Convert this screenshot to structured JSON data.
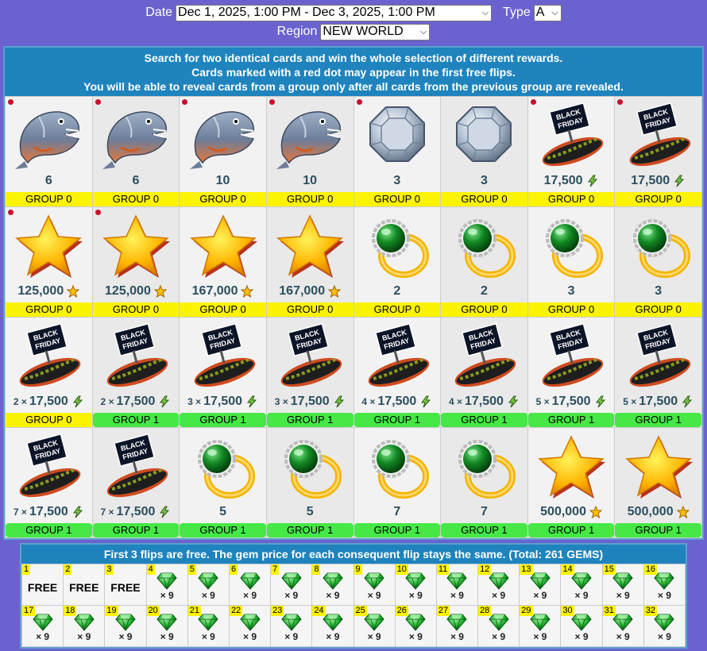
{
  "filters": {
    "date_label": "Date",
    "date_value": "Dec 1, 2025, 1:00 PM - Dec 3, 2025, 1:00 PM",
    "type_label": "Type",
    "type_value": "A",
    "region_label": "Region",
    "region_value": "NEW WORLD"
  },
  "info": {
    "line1": "Search for two identical cards and win the whole selection of different rewards.",
    "line2": "Cards marked with a red dot may appear in the first free flips.",
    "line3": "You will be able to reveal cards from a group only after all cards from the previous group are revealed."
  },
  "cards": [
    {
      "icon": "piranha-icon",
      "mult": "",
      "value": "6",
      "value_icon": "",
      "group": "GROUP 0",
      "red_dot": true
    },
    {
      "icon": "piranha-icon",
      "mult": "",
      "value": "6",
      "value_icon": "",
      "group": "GROUP 0",
      "red_dot": true
    },
    {
      "icon": "piranha-icon",
      "mult": "",
      "value": "10",
      "value_icon": "",
      "group": "GROUP 0",
      "red_dot": true
    },
    {
      "icon": "piranha-icon",
      "mult": "",
      "value": "10",
      "value_icon": "",
      "group": "GROUP 0",
      "red_dot": true
    },
    {
      "icon": "diamond-icon",
      "mult": "",
      "value": "3",
      "value_icon": "",
      "group": "GROUP 0",
      "red_dot": true
    },
    {
      "icon": "diamond-icon",
      "mult": "",
      "value": "3",
      "value_icon": "",
      "group": "GROUP 0",
      "red_dot": false
    },
    {
      "icon": "hotdog-black-friday-icon",
      "mult": "",
      "value": "17,500",
      "value_icon": "bolt",
      "group": "GROUP 0",
      "red_dot": true
    },
    {
      "icon": "hotdog-black-friday-icon",
      "mult": "",
      "value": "17,500",
      "value_icon": "bolt",
      "group": "GROUP 0",
      "red_dot": true
    },
    {
      "icon": "star-icon",
      "mult": "",
      "value": "125,000",
      "value_icon": "star",
      "group": "GROUP 0",
      "red_dot": true
    },
    {
      "icon": "star-icon",
      "mult": "",
      "value": "125,000",
      "value_icon": "star",
      "group": "GROUP 0",
      "red_dot": true
    },
    {
      "icon": "star-icon",
      "mult": "",
      "value": "167,000",
      "value_icon": "star",
      "group": "GROUP 0",
      "red_dot": false
    },
    {
      "icon": "star-icon",
      "mult": "",
      "value": "167,000",
      "value_icon": "star",
      "group": "GROUP 0",
      "red_dot": false
    },
    {
      "icon": "emerald-ring-icon",
      "mult": "",
      "value": "2",
      "value_icon": "",
      "group": "GROUP 0",
      "red_dot": false
    },
    {
      "icon": "emerald-ring-icon",
      "mult": "",
      "value": "2",
      "value_icon": "",
      "group": "GROUP 0",
      "red_dot": false
    },
    {
      "icon": "emerald-ring-icon",
      "mult": "",
      "value": "3",
      "value_icon": "",
      "group": "GROUP 0",
      "red_dot": false
    },
    {
      "icon": "emerald-ring-icon",
      "mult": "",
      "value": "3",
      "value_icon": "",
      "group": "GROUP 0",
      "red_dot": false
    },
    {
      "icon": "hotdog-black-friday-icon",
      "mult": "2 ×",
      "value": "17,500",
      "value_icon": "bolt",
      "group": "GROUP 0",
      "red_dot": false
    },
    {
      "icon": "hotdog-black-friday-icon",
      "mult": "2 ×",
      "value": "17,500",
      "value_icon": "bolt",
      "group": "GROUP 1",
      "red_dot": false
    },
    {
      "icon": "hotdog-black-friday-icon",
      "mult": "3 ×",
      "value": "17,500",
      "value_icon": "bolt",
      "group": "GROUP 1",
      "red_dot": false
    },
    {
      "icon": "hotdog-black-friday-icon",
      "mult": "3 ×",
      "value": "17,500",
      "value_icon": "bolt",
      "group": "GROUP 1",
      "red_dot": false
    },
    {
      "icon": "hotdog-black-friday-icon",
      "mult": "4 ×",
      "value": "17,500",
      "value_icon": "bolt",
      "group": "GROUP 1",
      "red_dot": false
    },
    {
      "icon": "hotdog-black-friday-icon",
      "mult": "4 ×",
      "value": "17,500",
      "value_icon": "bolt",
      "group": "GROUP 1",
      "red_dot": false
    },
    {
      "icon": "hotdog-black-friday-icon",
      "mult": "5 ×",
      "value": "17,500",
      "value_icon": "bolt",
      "group": "GROUP 1",
      "red_dot": false
    },
    {
      "icon": "hotdog-black-friday-icon",
      "mult": "5 ×",
      "value": "17,500",
      "value_icon": "bolt",
      "group": "GROUP 1",
      "red_dot": false
    },
    {
      "icon": "hotdog-black-friday-icon",
      "mult": "7 ×",
      "value": "17,500",
      "value_icon": "bolt",
      "group": "GROUP 1",
      "red_dot": false
    },
    {
      "icon": "hotdog-black-friday-icon",
      "mult": "7 ×",
      "value": "17,500",
      "value_icon": "bolt",
      "group": "GROUP 1",
      "red_dot": false
    },
    {
      "icon": "emerald-ring-icon",
      "mult": "",
      "value": "5",
      "value_icon": "",
      "group": "GROUP 1",
      "red_dot": false
    },
    {
      "icon": "emerald-ring-icon",
      "mult": "",
      "value": "5",
      "value_icon": "",
      "group": "GROUP 1",
      "red_dot": false
    },
    {
      "icon": "emerald-ring-icon",
      "mult": "",
      "value": "7",
      "value_icon": "",
      "group": "GROUP 1",
      "red_dot": false
    },
    {
      "icon": "emerald-ring-icon",
      "mult": "",
      "value": "7",
      "value_icon": "",
      "group": "GROUP 1",
      "red_dot": false
    },
    {
      "icon": "star-icon",
      "mult": "",
      "value": "500,000",
      "value_icon": "star",
      "group": "GROUP 1",
      "red_dot": false
    },
    {
      "icon": "star-icon",
      "mult": "",
      "value": "500,000",
      "value_icon": "star",
      "group": "GROUP 1",
      "red_dot": false
    }
  ],
  "flips_info": "First 3 flips are free. The gem price for each consequent flip stays the same. (Total: 261 GEMS)",
  "flips": [
    {
      "n": "1",
      "free": "FREE"
    },
    {
      "n": "2",
      "free": "FREE"
    },
    {
      "n": "3",
      "free": "FREE"
    },
    {
      "n": "4",
      "cost": "× 9"
    },
    {
      "n": "5",
      "cost": "× 9"
    },
    {
      "n": "6",
      "cost": "× 9"
    },
    {
      "n": "7",
      "cost": "× 9"
    },
    {
      "n": "8",
      "cost": "× 9"
    },
    {
      "n": "9",
      "cost": "× 9"
    },
    {
      "n": "10",
      "cost": "× 9"
    },
    {
      "n": "11",
      "cost": "× 9"
    },
    {
      "n": "12",
      "cost": "× 9"
    },
    {
      "n": "13",
      "cost": "× 9"
    },
    {
      "n": "14",
      "cost": "× 9"
    },
    {
      "n": "15",
      "cost": "× 9"
    },
    {
      "n": "16",
      "cost": "× 9"
    },
    {
      "n": "17",
      "cost": "× 9"
    },
    {
      "n": "18",
      "cost": "× 9"
    },
    {
      "n": "19",
      "cost": "× 9"
    },
    {
      "n": "20",
      "cost": "× 9"
    },
    {
      "n": "21",
      "cost": "× 9"
    },
    {
      "n": "22",
      "cost": "× 9"
    },
    {
      "n": "23",
      "cost": "× 9"
    },
    {
      "n": "24",
      "cost": "× 9"
    },
    {
      "n": "25",
      "cost": "× 9"
    },
    {
      "n": "26",
      "cost": "× 9"
    },
    {
      "n": "27",
      "cost": "× 9"
    },
    {
      "n": "28",
      "cost": "× 9"
    },
    {
      "n": "29",
      "cost": "× 9"
    },
    {
      "n": "30",
      "cost": "× 9"
    },
    {
      "n": "31",
      "cost": "× 9"
    },
    {
      "n": "32",
      "cost": "× 9"
    }
  ],
  "colors": {
    "background": "#6a63cf",
    "info_bar": "#1f84bd",
    "group0": "#fbf300",
    "group1": "#45e845",
    "red_dot": "#c8102e",
    "gem": "#1fae2c"
  }
}
